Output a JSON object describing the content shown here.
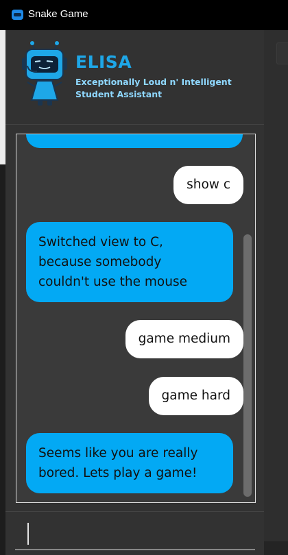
{
  "window": {
    "title": "Snake Game",
    "icon": "snake-game-app-icon"
  },
  "assistant": {
    "name": "ELISA",
    "subtitle_line1": "Exceptionally Loud n' Intelligent",
    "subtitle_line2": "Student Assistant",
    "avatar_icon": "robot-avatar-icon",
    "name_color": "#1ea7e8",
    "subtitle_color": "#8fd8ff"
  },
  "chat": {
    "bubble_bot_color": "#03a9f4",
    "bubble_user_color": "#ffffff",
    "messages": [
      {
        "from": "user",
        "text": "show c"
      },
      {
        "from": "bot",
        "line1": "Switched view to C,",
        "line2": "because somebody",
        "line3": "couldn't use the mouse"
      },
      {
        "from": "user",
        "text": "game medium"
      },
      {
        "from": "user",
        "text": "game hard"
      },
      {
        "from": "bot",
        "line1": "Seems like you are really",
        "line2": "bored. Lets play a game!"
      }
    ]
  },
  "input": {
    "value": "",
    "placeholder": ""
  }
}
